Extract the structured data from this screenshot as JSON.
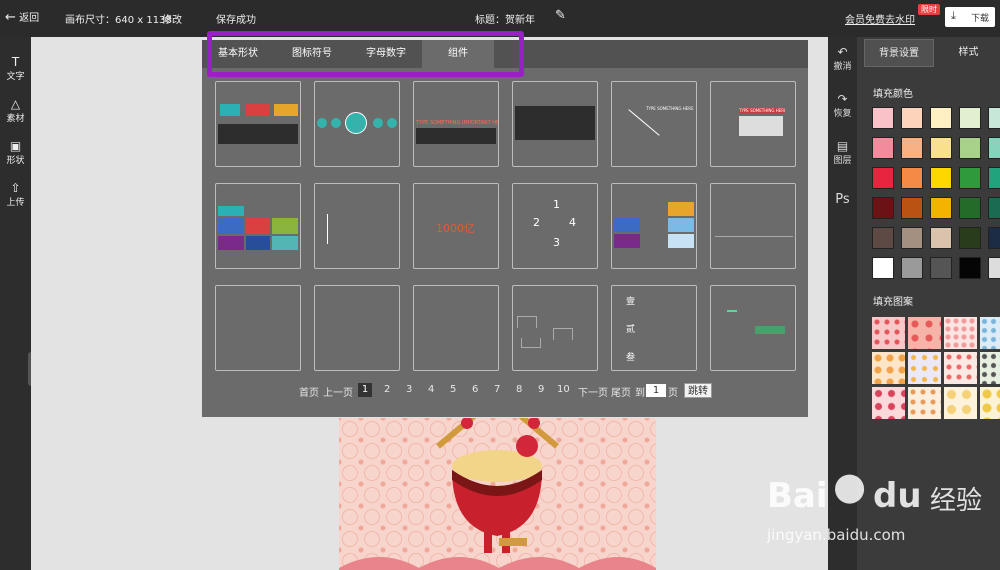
{
  "header": {
    "back_label": "返回",
    "canvas_size": "画布尺寸：640 x 1138",
    "edit_label": "修改",
    "save_status": "保存成功",
    "title": "标题：贺新年",
    "vip_link": "会员免费去水印",
    "limited_badge": "限时",
    "download_label": "下载"
  },
  "left_tools": [
    {
      "label": "文字",
      "icon": "text-icon"
    },
    {
      "label": "素材",
      "icon": "shapes-icon"
    },
    {
      "label": "形状",
      "icon": "image-icon"
    },
    {
      "label": "上传",
      "icon": "upload-icon"
    }
  ],
  "right_tools": [
    {
      "label": "撤消",
      "icon": "undo-icon"
    },
    {
      "label": "恢复",
      "icon": "redo-icon"
    },
    {
      "label": "图层",
      "icon": "layers-icon"
    },
    {
      "label": "Ps",
      "icon": "ps-icon"
    }
  ],
  "right_panel": {
    "tabs": [
      "背景设置",
      "样式"
    ],
    "fill_color_label": "填充颜色",
    "fill_pattern_label": "填充图案",
    "colors": [
      "#f9c1c8",
      "#fcd4bc",
      "#fff0c4",
      "#e2f0cf",
      "#c7e8d9",
      "#f18c9d",
      "#f8b184",
      "#f9e08f",
      "#a8d18a",
      "#88d3bb",
      "#e8253f",
      "#f38b47",
      "#ffd700",
      "#2e9a3b",
      "#21a47e",
      "#6a1214",
      "#b95212",
      "#f3b300",
      "#246b29",
      "#1b6a52",
      "#5e4a44",
      "#a39080",
      "#d9c3ad",
      "#293c1c",
      "#1b2c44",
      "#ffffff",
      "#9a9a9a",
      "#555555",
      "#050505",
      "#dddddd"
    ]
  },
  "overlay": {
    "tabs": [
      "基本形状",
      "图标符号",
      "字母数字",
      "组件"
    ],
    "active_tab": 3,
    "tile_texts": {
      "t1_label1": "TYPE SOMETHING IMPORTANT HERE",
      "t2_label1": "TYPE SOMETHING HERE",
      "t3_label1": "TYPE SOMETHING HERE",
      "t4_label1": "1000亿",
      "t5_n1": "1",
      "t5_n2": "2",
      "t5_n3": "3",
      "t5_n4": "4",
      "t6_c1": "壹",
      "t6_c2": "贰",
      "t6_c3": "叁"
    },
    "pagination": {
      "first": "首页",
      "prev": "上一页",
      "pages": [
        "1",
        "2",
        "3",
        "4",
        "5",
        "6",
        "7",
        "8",
        "9",
        "10"
      ],
      "current": "1",
      "next": "下一页",
      "last": "尾页",
      "goto_prefix": "到",
      "goto_value": "1",
      "goto_suffix": "页",
      "jump_label": "跳转"
    }
  },
  "watermark": {
    "logo_text": "Bai",
    "logo_text2": "du",
    "jingyan": "经验",
    "url": "jingyan.baidu.com"
  }
}
